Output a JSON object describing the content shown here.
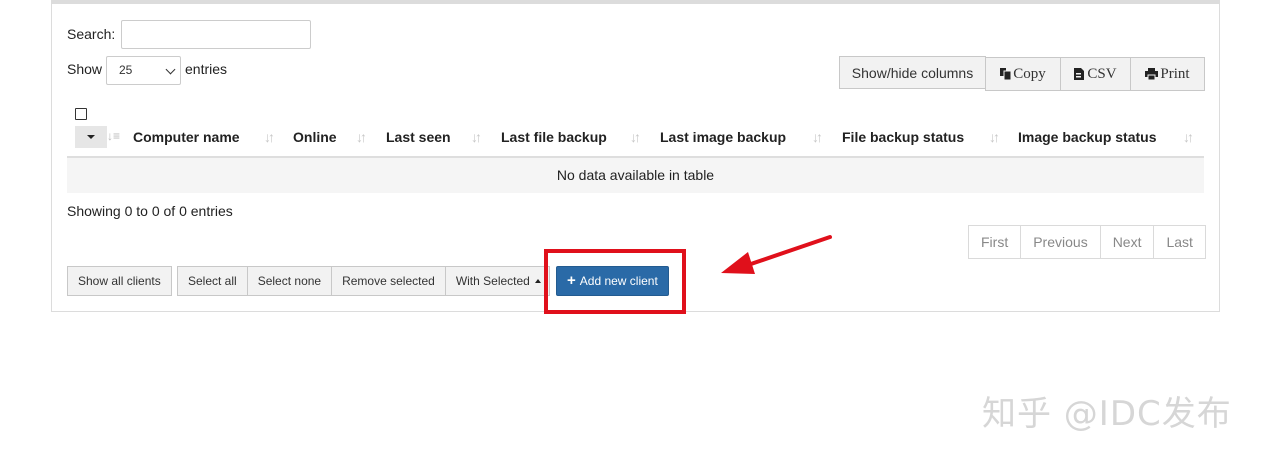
{
  "search": {
    "label": "Search:",
    "value": ""
  },
  "length": {
    "label_before": "Show",
    "selected": "25",
    "label_after": "entries"
  },
  "toolbar": {
    "show_hide": "Show/hide columns",
    "copy": "Copy",
    "csv": "CSV",
    "print": "Print"
  },
  "table": {
    "columns": [
      "Computer name",
      "Online",
      "Last seen",
      "Last file backup",
      "Last image backup",
      "File backup status",
      "Image backup status"
    ],
    "empty_message": "No data available in table"
  },
  "info": "Showing 0 to 0 of 0 entries",
  "pagination": [
    "First",
    "Previous",
    "Next",
    "Last"
  ],
  "actions": {
    "show_all": "Show all clients",
    "select_all": "Select all",
    "select_none": "Select none",
    "remove_selected": "Remove selected",
    "with_selected": "With Selected",
    "add_new": "Add new client"
  },
  "annotation": {
    "highlight_color": "#e0101b",
    "arrow_color": "#e0101b"
  },
  "watermark": "知乎 @IDC发布"
}
